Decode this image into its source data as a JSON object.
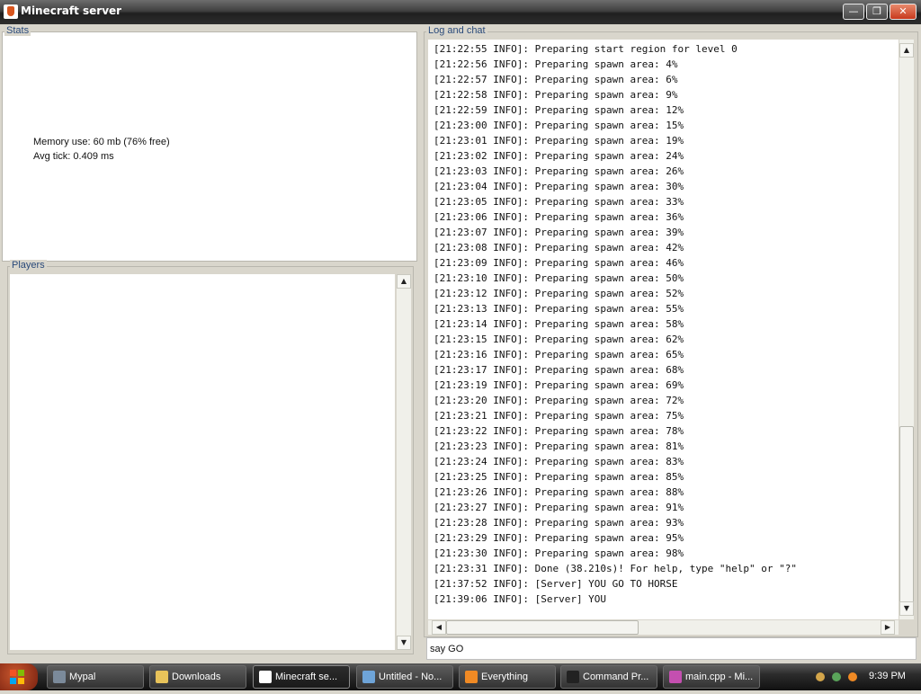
{
  "window": {
    "title": "Minecraft server"
  },
  "stats": {
    "legend": "Stats",
    "memory": "Memory use: 60 mb (76% free)",
    "avg_tick": "Avg tick: 0.409 ms"
  },
  "players": {
    "legend": "Players"
  },
  "log": {
    "legend": "Log and chat",
    "lines": [
      "[21:22:55 INFO]: Preparing start region for level 0",
      "[21:22:56 INFO]: Preparing spawn area: 4%",
      "[21:22:57 INFO]: Preparing spawn area: 6%",
      "[21:22:58 INFO]: Preparing spawn area: 9%",
      "[21:22:59 INFO]: Preparing spawn area: 12%",
      "[21:23:00 INFO]: Preparing spawn area: 15%",
      "[21:23:01 INFO]: Preparing spawn area: 19%",
      "[21:23:02 INFO]: Preparing spawn area: 24%",
      "[21:23:03 INFO]: Preparing spawn area: 26%",
      "[21:23:04 INFO]: Preparing spawn area: 30%",
      "[21:23:05 INFO]: Preparing spawn area: 33%",
      "[21:23:06 INFO]: Preparing spawn area: 36%",
      "[21:23:07 INFO]: Preparing spawn area: 39%",
      "[21:23:08 INFO]: Preparing spawn area: 42%",
      "[21:23:09 INFO]: Preparing spawn area: 46%",
      "[21:23:10 INFO]: Preparing spawn area: 50%",
      "[21:23:12 INFO]: Preparing spawn area: 52%",
      "[21:23:13 INFO]: Preparing spawn area: 55%",
      "[21:23:14 INFO]: Preparing spawn area: 58%",
      "[21:23:15 INFO]: Preparing spawn area: 62%",
      "[21:23:16 INFO]: Preparing spawn area: 65%",
      "[21:23:17 INFO]: Preparing spawn area: 68%",
      "[21:23:19 INFO]: Preparing spawn area: 69%",
      "[21:23:20 INFO]: Preparing spawn area: 72%",
      "[21:23:21 INFO]: Preparing spawn area: 75%",
      "[21:23:22 INFO]: Preparing spawn area: 78%",
      "[21:23:23 INFO]: Preparing spawn area: 81%",
      "[21:23:24 INFO]: Preparing spawn area: 83%",
      "[21:23:25 INFO]: Preparing spawn area: 85%",
      "[21:23:26 INFO]: Preparing spawn area: 88%",
      "[21:23:27 INFO]: Preparing spawn area: 91%",
      "[21:23:28 INFO]: Preparing spawn area: 93%",
      "[21:23:29 INFO]: Preparing spawn area: 95%",
      "[21:23:30 INFO]: Preparing spawn area: 98%",
      "[21:23:31 INFO]: Done (38.210s)! For help, type \"help\" or \"?\"",
      "[21:37:52 INFO]: [Server] YOU GO TO HORSE",
      "[21:39:06 INFO]: [Server] YOU"
    ]
  },
  "command": {
    "value": "say GO"
  },
  "taskbar": {
    "items": [
      {
        "label": "Mypal",
        "icon": "globe-icon",
        "color": "#7b8a9a"
      },
      {
        "label": "Downloads",
        "icon": "folder-icon",
        "color": "#e8c35a"
      },
      {
        "label": "Minecraft se...",
        "icon": "java-icon",
        "color": "#ffffff",
        "active": true
      },
      {
        "label": "Untitled - No...",
        "icon": "notepad-icon",
        "color": "#6ea4d8"
      },
      {
        "label": "Everything",
        "icon": "search-icon",
        "color": "#f08a24"
      },
      {
        "label": "Command Pr...",
        "icon": "terminal-icon",
        "color": "#222222"
      },
      {
        "label": "main.cpp - Mi...",
        "icon": "code-icon",
        "color": "#c44fb0"
      }
    ],
    "clock": "9:39 PM"
  },
  "colors": {
    "legend_text": "#2a4a7a",
    "close_button": "#c8391d"
  }
}
